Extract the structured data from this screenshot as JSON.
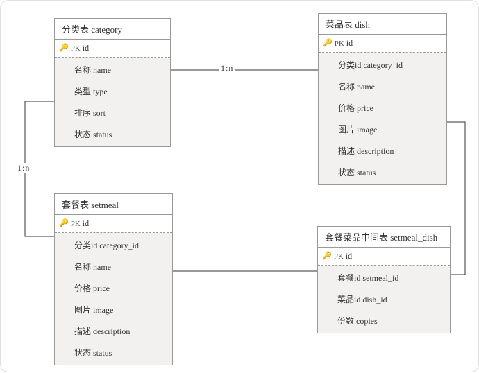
{
  "entities": {
    "category": {
      "title": "分类表 category",
      "pk": "id",
      "fields": [
        "名称 name",
        "类型 type",
        "排序 sort",
        "状态 status"
      ]
    },
    "dish": {
      "title": "菜品表 dish",
      "pk": "id",
      "fields": [
        "分类id category_id",
        "名称 name",
        "价格 price",
        "图片 image",
        "描述 description",
        "状态 status"
      ]
    },
    "setmeal": {
      "title": "套餐表 setmeal",
      "pk": "id",
      "fields": [
        "分类id category_id",
        "名称 name",
        "价格 price",
        "图片 image",
        "描述 description",
        "状态 status"
      ]
    },
    "setmeal_dish": {
      "title": "套餐菜品中间表 setmeal_dish",
      "pk": "id",
      "fields": [
        "套餐id setmeal_id",
        "菜品id dish_id",
        "份数 copies"
      ]
    }
  },
  "labels": {
    "pk_prefix": "PK",
    "rel_category_dish": "1:n",
    "rel_category_setmeal": "1:n"
  }
}
